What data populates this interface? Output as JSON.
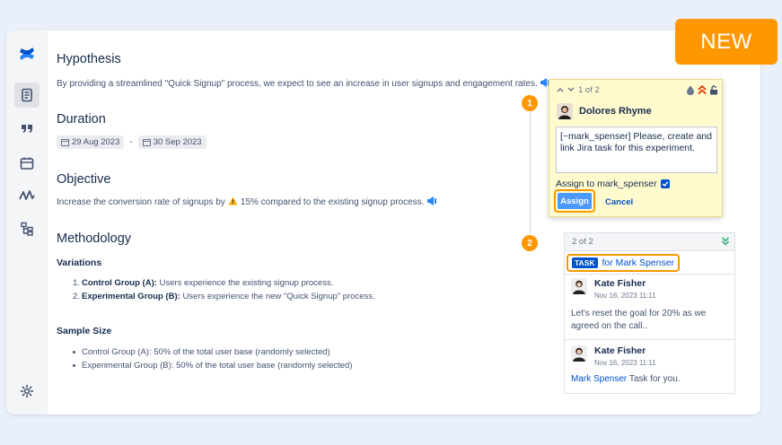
{
  "badge": {
    "new_label": "NEW"
  },
  "sidebar": {
    "items": [
      {
        "icon": "confluence-logo-icon"
      },
      {
        "icon": "page-icon"
      },
      {
        "icon": "quote-icon"
      },
      {
        "icon": "calendar-icon"
      },
      {
        "icon": "analytics-icon"
      },
      {
        "icon": "tree-icon"
      },
      {
        "icon": "gear-icon"
      }
    ]
  },
  "page": {
    "hypothesis": {
      "heading": "Hypothesis",
      "text": "By providing a streamlined \"Quick Signup\" process, we expect to see an increase in user signups and engagement rates."
    },
    "duration": {
      "heading": "Duration",
      "start": "29 Aug 2023",
      "separator": "-",
      "end": "30 Sep 2023"
    },
    "objective": {
      "heading": "Objective",
      "text_before": "Increase the conversion rate of signups by",
      "text_after": "15% compared to the existing signup process."
    },
    "methodology": {
      "heading": "Methodology",
      "variations_heading": "Variations",
      "variations": [
        {
          "num": "1.",
          "bold": "Control Group (A):",
          "text": "Users experience the existing signup process."
        },
        {
          "num": "2.",
          "bold": "Experimental Group (B):",
          "text": "Users experience the new \"Quick Signup\" process."
        }
      ],
      "sample_heading": "Sample Size",
      "sample": [
        "Control Group (A): 50% of the total user base (randomly selected)",
        "Experimental Group (B): 50% of the total user base (randomly selected)"
      ]
    }
  },
  "steps": {
    "one": "1",
    "two": "2"
  },
  "comment1": {
    "counter": "1 of 2",
    "author": "Dolores Rhyme",
    "text": "[~mark_spenser] Please, create and link Jira task for this experiment.",
    "assign_label": "Assign to mark_spenser",
    "assign_button": "Assign",
    "cancel_button": "Cancel"
  },
  "comment2": {
    "counter": "2 of 2",
    "task_lozenge": "TASK",
    "task_for": "for Mark Spenser",
    "entries": [
      {
        "author": "Kate Fisher",
        "time": "Nov 16, 2023 11:11",
        "text": "Let's reset the goal for 20% as we agreed on the call..",
        "mention": ""
      },
      {
        "author": "Kate Fisher",
        "time": "Nov 16, 2023 11:11",
        "text": " Task for you.",
        "mention": "Mark Spenser"
      }
    ]
  },
  "colors": {
    "accent": "#ff9800",
    "link": "#0052cc",
    "comment_bg": "#fffbcf"
  }
}
